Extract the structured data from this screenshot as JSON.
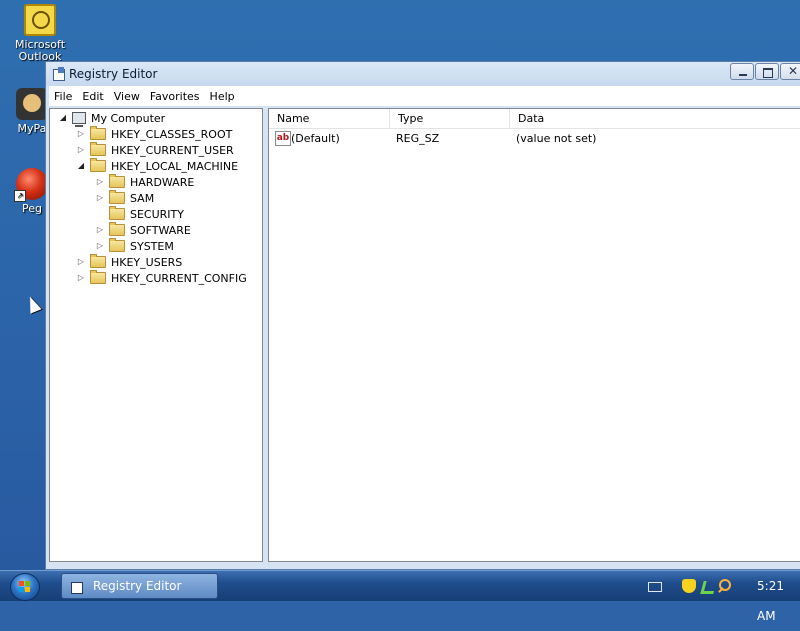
{
  "desktop": {
    "icons": [
      {
        "label": "Microsoft Outlook",
        "icon": "outlook-icon"
      },
      {
        "label": "MyPa",
        "icon": "mypc-icon"
      },
      {
        "label": "Peg",
        "icon": "peg-shortcut-icon"
      }
    ]
  },
  "window": {
    "title": "Registry Editor",
    "menu": [
      "File",
      "Edit",
      "View",
      "Favorites",
      "Help"
    ],
    "tree": [
      {
        "label": "My Computer",
        "expander": "down",
        "icon": "computer-icon"
      },
      {
        "label": "HKEY_CLASSES_ROOT",
        "expander": "right",
        "icon": "folder-icon"
      },
      {
        "label": "HKEY_CURRENT_USER",
        "expander": "right",
        "icon": "folder-icon"
      },
      {
        "label": "HKEY_LOCAL_MACHINE",
        "expander": "down",
        "icon": "folder-icon"
      },
      {
        "label": "HARDWARE",
        "expander": "right",
        "icon": "folder-icon"
      },
      {
        "label": "SAM",
        "expander": "right",
        "icon": "folder-icon"
      },
      {
        "label": "SECURITY",
        "expander": "",
        "icon": "folder-icon"
      },
      {
        "label": "SOFTWARE",
        "expander": "right",
        "icon": "folder-icon"
      },
      {
        "label": "SYSTEM",
        "expander": "right",
        "icon": "folder-icon"
      },
      {
        "label": "HKEY_USERS",
        "expander": "right",
        "icon": "folder-icon"
      },
      {
        "label": "HKEY_CURRENT_CONFIG",
        "expander": "right",
        "icon": "folder-icon"
      }
    ],
    "columns": [
      "Name",
      "Type",
      "Data"
    ],
    "values": [
      {
        "name": "(Default)",
        "type": "REG_SZ",
        "data": "(value not set)",
        "icon_text": "ab"
      }
    ]
  },
  "taskbar": {
    "task_label": "Registry Editor",
    "clock": "5:21 AM"
  },
  "colors": {
    "desktop": "#2c64a9",
    "taskbar": "#1f4d8c"
  }
}
